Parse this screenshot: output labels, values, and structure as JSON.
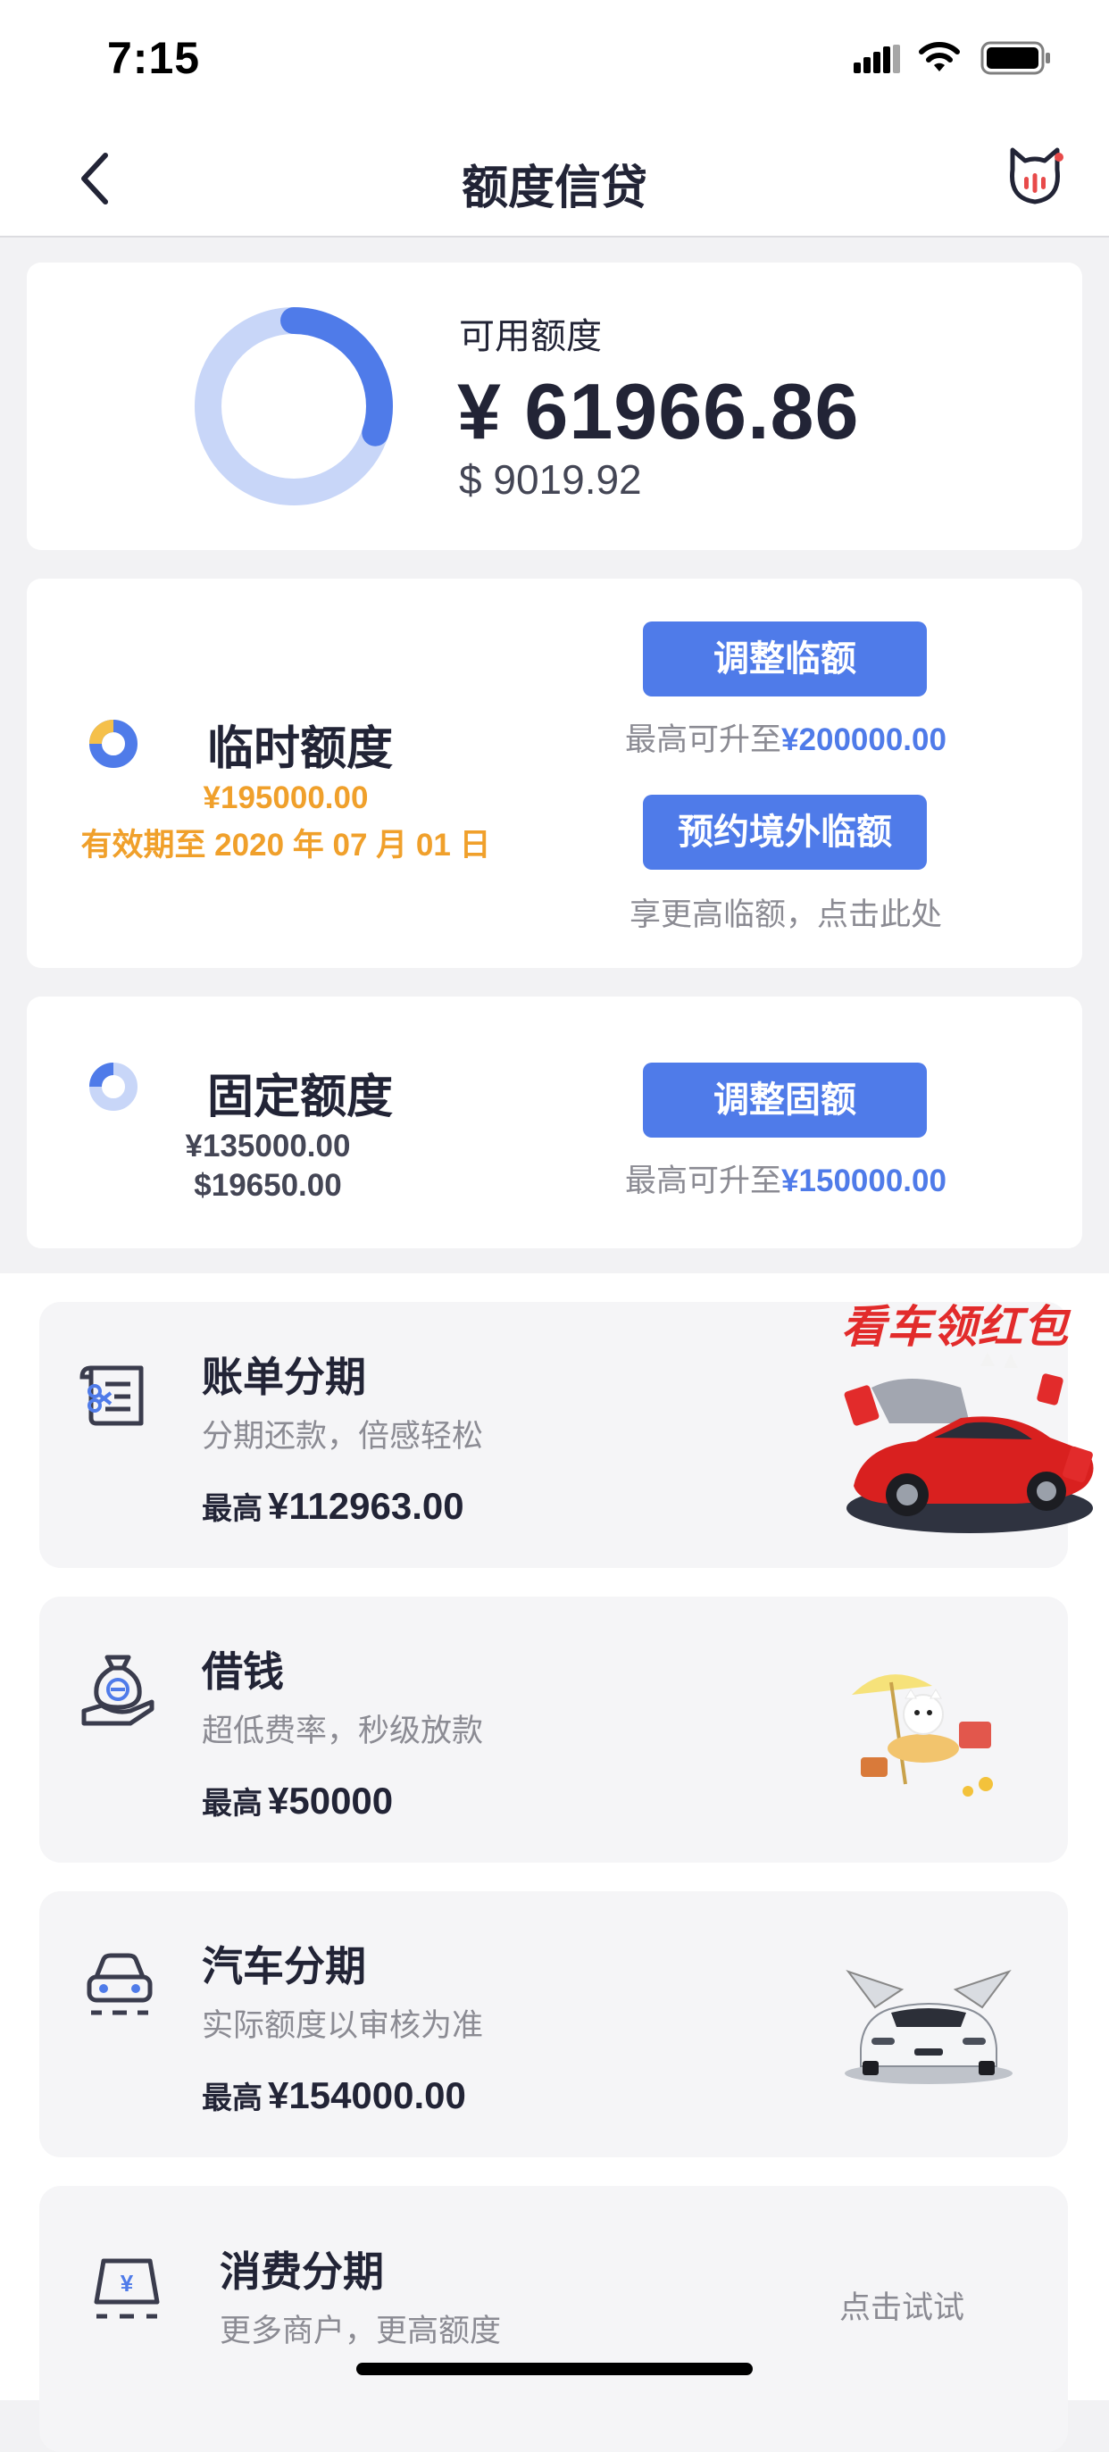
{
  "status_bar": {
    "time": "7:15"
  },
  "nav": {
    "title": "额度信贷"
  },
  "available": {
    "label": "可用额度",
    "cny": "¥ 61966.86",
    "usd": "$ 9019.92",
    "ring_fraction": 0.3
  },
  "temp_credit": {
    "title": "临时额度",
    "amount": "¥195000.00",
    "validity": "有效期至 2020 年 07 月 01 日",
    "adjust_button": "调整临额",
    "adjust_note_prefix": "最高可升至",
    "adjust_note_amount": "¥200000.00",
    "reserve_button": "预约境外临额",
    "reserve_note": "享更高临额，点击此处"
  },
  "fixed_credit": {
    "title": "固定额度",
    "cny": "¥135000.00",
    "usd": "$19650.00",
    "adjust_button": "调整固额",
    "adjust_note_prefix": "最高可升至",
    "adjust_note_amount": "¥150000.00"
  },
  "products": [
    {
      "title": "账单分期",
      "subtitle": "分期还款，倍感轻松",
      "max_prefix": "最高",
      "max_value": "¥112963.00",
      "icon": "bill-installment-icon",
      "promo_text": "看车领红包"
    },
    {
      "title": "借钱",
      "subtitle": "超低费率，秒级放款",
      "max_prefix": "最高",
      "max_value": "¥50000",
      "icon": "money-bag-icon"
    },
    {
      "title": "汽车分期",
      "subtitle": "实际额度以审核为准",
      "max_prefix": "最高",
      "max_value": "¥154000.00",
      "icon": "car-icon"
    },
    {
      "title": "消费分期",
      "subtitle": "更多商户，更高额度",
      "action": "点击试试",
      "icon": "shop-icon"
    }
  ],
  "colors": {
    "accent": "#4f7be9",
    "orange": "#f0a02b",
    "ring_light": "#c8d6f8"
  }
}
